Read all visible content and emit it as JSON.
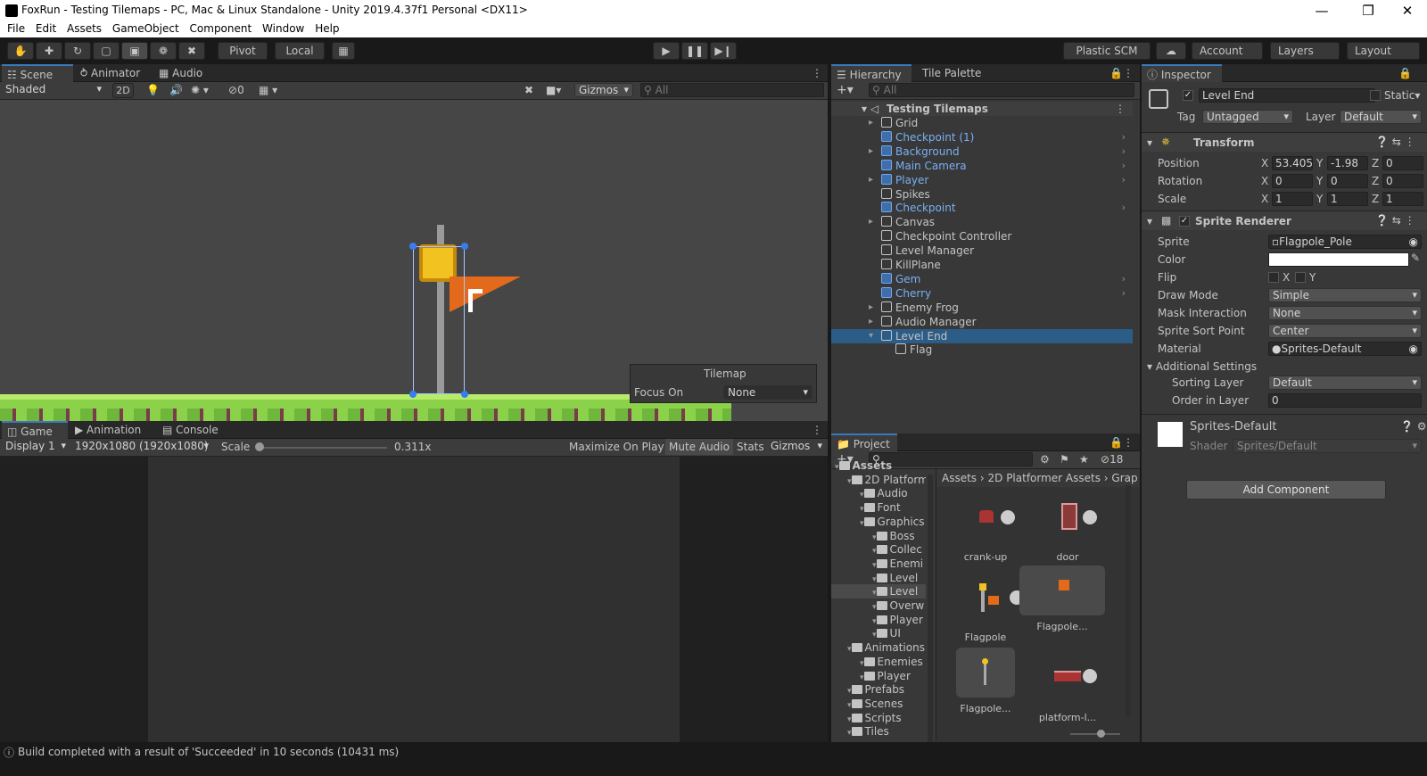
{
  "window": {
    "title": "FoxRun - Testing Tilemaps - PC, Mac & Linux Standalone - Unity 2019.4.37f1 Personal <DX11>",
    "min": "—",
    "max": "❐",
    "close": "✕"
  },
  "menu": [
    "File",
    "Edit",
    "Assets",
    "GameObject",
    "Component",
    "Window",
    "Help"
  ],
  "toolbar": {
    "pivot": "Pivot",
    "local": "Local",
    "plastic": "Plastic SCM",
    "account": "Account",
    "layers": "Layers",
    "layout": "Layout"
  },
  "scene": {
    "tabs": [
      "Scene",
      "Animator",
      "Audio Mixer"
    ],
    "shading": "Shaded",
    "mode2d": "2D",
    "hidden_count": "0",
    "gizmos": "Gizmos",
    "search_placeholder": "All",
    "overlay": {
      "title": "Tilemap",
      "focus_label": "Focus On",
      "focus_value": "None"
    }
  },
  "game": {
    "tabs": [
      "Game",
      "Animation",
      "Console"
    ],
    "display": "Display 1",
    "resolution": "1920x1080 (1920x1080)",
    "scale_label": "Scale",
    "scale_value": "0.311x",
    "maximize": "Maximize On Play",
    "mute": "Mute Audio",
    "stats": "Stats",
    "gizmos": "Gizmos"
  },
  "hierarchy": {
    "tabs": [
      "Hierarchy",
      "Tile Palette"
    ],
    "search_placeholder": "All",
    "scene_name": "Testing Tilemaps",
    "items": [
      {
        "label": "Grid",
        "prefab": false,
        "expand": true,
        "arrow": false
      },
      {
        "label": "Checkpoint (1)",
        "prefab": true,
        "expand": false,
        "arrow": true
      },
      {
        "label": "Background",
        "prefab": true,
        "expand": true,
        "arrow": true
      },
      {
        "label": "Main Camera",
        "prefab": true,
        "expand": false,
        "arrow": true
      },
      {
        "label": "Player",
        "prefab": true,
        "expand": true,
        "arrow": true
      },
      {
        "label": "Spikes",
        "prefab": false,
        "expand": false,
        "arrow": false
      },
      {
        "label": "Checkpoint",
        "prefab": true,
        "expand": false,
        "arrow": true
      },
      {
        "label": "Canvas",
        "prefab": false,
        "expand": true,
        "arrow": false
      },
      {
        "label": "Checkpoint Controller",
        "prefab": false,
        "expand": false,
        "arrow": false
      },
      {
        "label": "Level Manager",
        "prefab": false,
        "expand": false,
        "arrow": false
      },
      {
        "label": "KillPlane",
        "prefab": false,
        "expand": false,
        "arrow": false
      },
      {
        "label": "Gem",
        "prefab": true,
        "expand": false,
        "arrow": true
      },
      {
        "label": "Cherry",
        "prefab": true,
        "expand": false,
        "arrow": true
      },
      {
        "label": "Enemy Frog",
        "prefab": false,
        "expand": true,
        "arrow": false
      },
      {
        "label": "Audio Manager",
        "prefab": false,
        "expand": true,
        "arrow": false
      },
      {
        "label": "Level End",
        "prefab": false,
        "expand": true,
        "arrow": false
      },
      {
        "label": "Flag",
        "prefab": false,
        "expand": false,
        "arrow": false
      }
    ]
  },
  "project": {
    "tab": "Project",
    "hidden_count": "18",
    "breadcrumb": [
      "Assets",
      "2D Platformer Assets",
      "Grap"
    ],
    "tree": [
      {
        "label": "Assets",
        "indent": 0,
        "bold": true
      },
      {
        "label": "2D Platform",
        "indent": 1
      },
      {
        "label": "Audio",
        "indent": 2
      },
      {
        "label": "Font",
        "indent": 2
      },
      {
        "label": "Graphics",
        "indent": 2
      },
      {
        "label": "Boss",
        "indent": 3
      },
      {
        "label": "Collec",
        "indent": 3
      },
      {
        "label": "Enemi",
        "indent": 3
      },
      {
        "label": "Level",
        "indent": 3
      },
      {
        "label": "Level",
        "indent": 3,
        "selected": true
      },
      {
        "label": "Overw",
        "indent": 3
      },
      {
        "label": "Player",
        "indent": 3
      },
      {
        "label": "UI",
        "indent": 3
      },
      {
        "label": "Animations",
        "indent": 1
      },
      {
        "label": "Enemies",
        "indent": 2
      },
      {
        "label": "Player",
        "indent": 2
      },
      {
        "label": "Prefabs",
        "indent": 1
      },
      {
        "label": "Scenes",
        "indent": 1
      },
      {
        "label": "Scripts",
        "indent": 1
      },
      {
        "label": "Tiles",
        "indent": 1
      }
    ],
    "assets": [
      "crank-up",
      "door",
      "Flagpole",
      "Flagpole...",
      "Flagpole...",
      "platform-l..."
    ]
  },
  "inspector": {
    "tab": "Inspector",
    "object_name": "Level End",
    "static": "Static",
    "tag_label": "Tag",
    "tag": "Untagged",
    "layer_label": "Layer",
    "layer": "Default",
    "transform": {
      "title": "Transform",
      "position_label": "Position",
      "rotation_label": "Rotation",
      "scale_label": "Scale",
      "position": [
        "53.405",
        "-1.98",
        "0"
      ],
      "rotation": [
        "0",
        "0",
        "0"
      ],
      "scale": [
        "1",
        "1",
        "1"
      ]
    },
    "sprite_renderer": {
      "title": "Sprite Renderer",
      "sprite_label": "Sprite",
      "sprite": "Flagpole_Pole",
      "color_label": "Color",
      "flip_label": "Flip",
      "flip_x": "X",
      "flip_y": "Y",
      "draw_mode_label": "Draw Mode",
      "draw_mode": "Simple",
      "mask_label": "Mask Interaction",
      "mask": "None",
      "sort_point_label": "Sprite Sort Point",
      "sort_point": "Center",
      "material_label": "Material",
      "material": "Sprites-Default",
      "additional": "Additional Settings",
      "sorting_layer_label": "Sorting Layer",
      "sorting_layer": "Default",
      "order_label": "Order in Layer",
      "order": "0"
    },
    "material_block": {
      "name": "Sprites-Default",
      "shader_label": "Shader",
      "shader": "Sprites/Default"
    },
    "add_component": "Add Component"
  },
  "status": "Build completed with a result of 'Succeeded' in 10 seconds (10431 ms)"
}
